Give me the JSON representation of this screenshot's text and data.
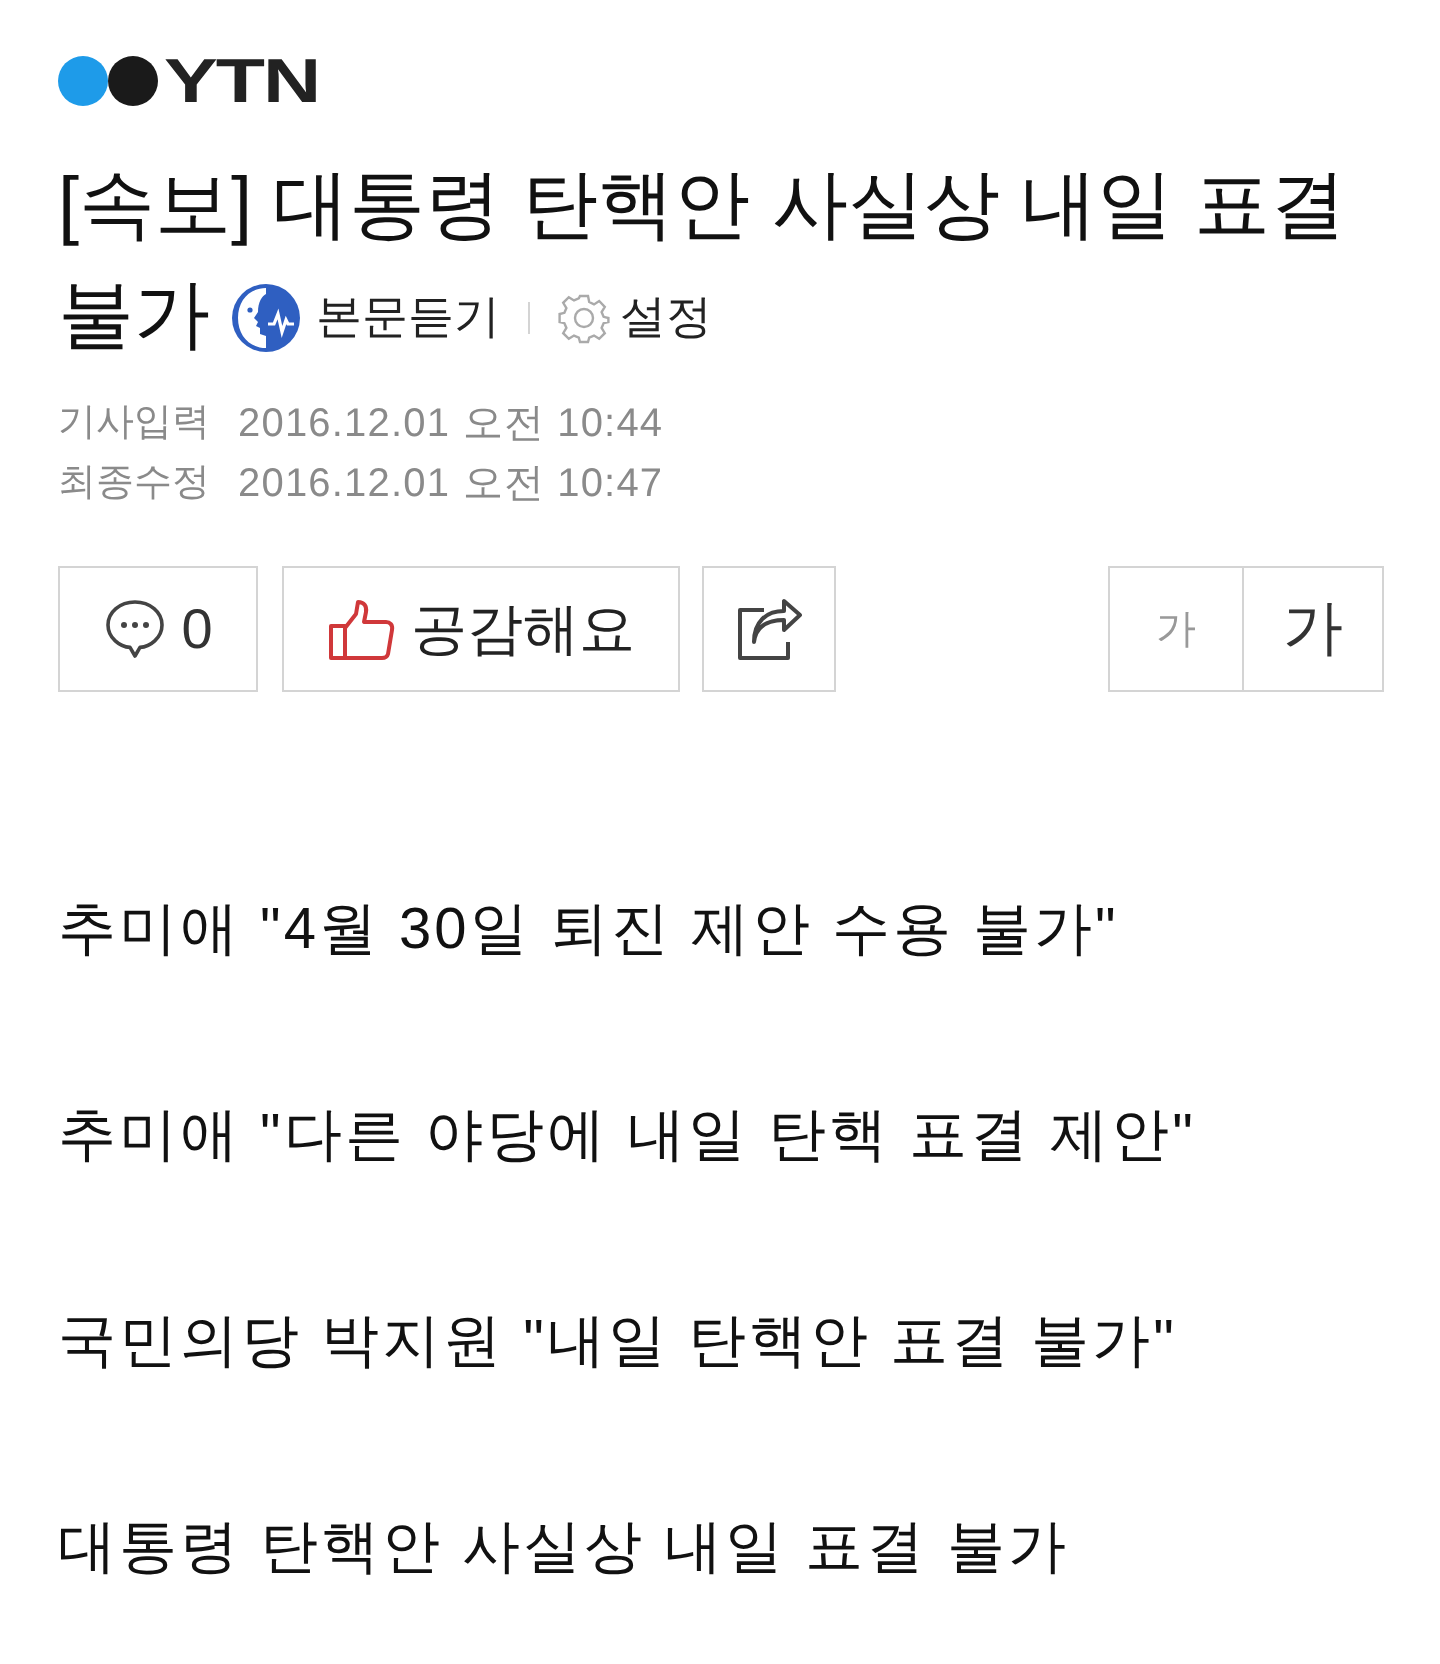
{
  "logo": {
    "text": "YTN"
  },
  "headline": {
    "title_lines": [
      "[속보] 대통령 탄핵안 사실상 내일 표결",
      "불가"
    ],
    "listen": "본문듣기",
    "settings": "설정"
  },
  "meta": [
    {
      "label": "기사입력",
      "value": "2016.12.01 오전 10:44"
    },
    {
      "label": "최종수정",
      "value": "2016.12.01 오전 10:47"
    }
  ],
  "actions": {
    "comments": "0",
    "like": "공감해요",
    "font_sizes": [
      {
        "label": "가",
        "kind": "smaller"
      },
      {
        "label": "가",
        "kind": "larger"
      }
    ]
  },
  "news_items": [
    "추미애 \"4월 30일 퇴진 제안 수용 불가\"",
    "추미애 \"다른 야당에 내일 탄핵 표결 제안\"",
    "국민의당 박지원 \"내일 탄핵안 표결 불가\"",
    "대통령 탄핵안 사실상 내일 표결 불가"
  ]
}
